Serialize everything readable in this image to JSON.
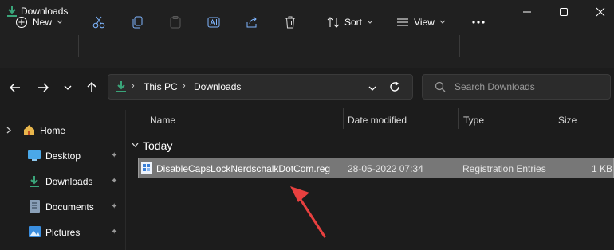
{
  "window": {
    "title": "Downloads"
  },
  "toolbar": {
    "new_label": "New",
    "sort_label": "Sort",
    "view_label": "View"
  },
  "address": {
    "segments": [
      "This PC",
      "Downloads"
    ]
  },
  "search": {
    "placeholder": "Search Downloads"
  },
  "sidebar": {
    "items": [
      {
        "label": "Home",
        "icon": "home-icon"
      },
      {
        "label": "Desktop",
        "icon": "desktop-icon",
        "pinned": true
      },
      {
        "label": "Downloads",
        "icon": "download-icon",
        "pinned": true
      },
      {
        "label": "Documents",
        "icon": "documents-icon",
        "pinned": true
      },
      {
        "label": "Pictures",
        "icon": "pictures-icon",
        "pinned": true
      }
    ]
  },
  "columns": [
    "Name",
    "Date modified",
    "Type",
    "Size"
  ],
  "group": "Today",
  "files": [
    {
      "name": "DisableCapsLockNerdschalkDotCom.reg",
      "date": "28-05-2022 07:34",
      "type": "Registration Entries",
      "size": "1 KB",
      "selected": true
    }
  ],
  "colors": {
    "accent": "#3aa57a",
    "folder": "#e8b64c",
    "selection": "#777777",
    "arrow": "#e8403f"
  }
}
